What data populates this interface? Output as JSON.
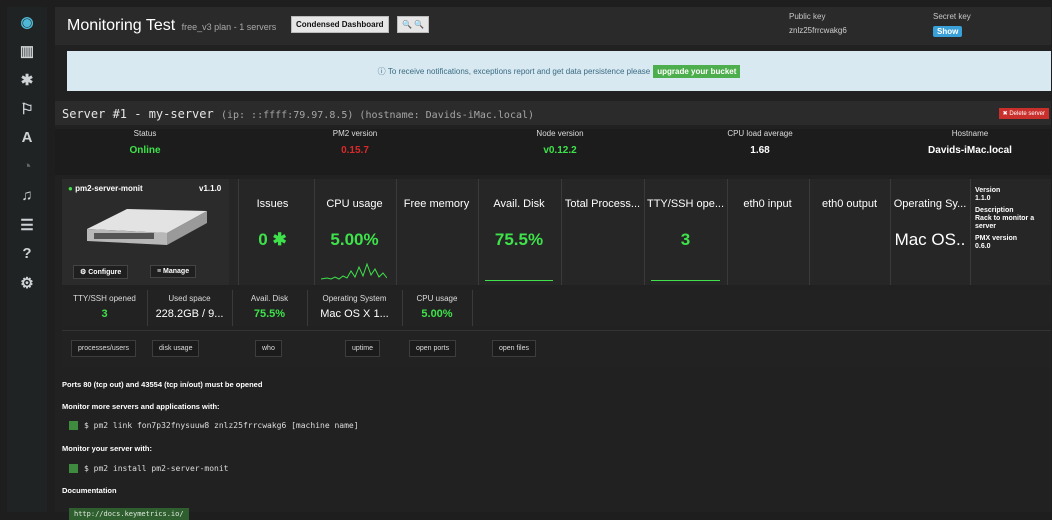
{
  "app": {
    "title": "Monitoring Test",
    "subtitle": "free_v3 plan - 1 servers",
    "condensed_label": "Condensed Dashboard",
    "public_key_label": "Public key",
    "public_key_value": "znlz25frrcwakg6",
    "secret_key_label": "Secret key",
    "show_label": "Show"
  },
  "notification": {
    "text": "To receive notifications, exceptions report and get data persistence please",
    "button": "upgrade your bucket"
  },
  "server": {
    "name": "Server #1 - my-server",
    "meta": "(ip: ::ffff:79.97.8.5) (hostname: Davids-iMac.local)",
    "delete_label": "Delete server",
    "stats": [
      {
        "label": "Status",
        "value": "Online",
        "color": "#3ee24a"
      },
      {
        "label": "PM2 version",
        "value": "0.15.7",
        "color": "#d82a2a"
      },
      {
        "label": "Node version",
        "value": "v0.12.2",
        "color": "#3ee24a"
      },
      {
        "label": "CPU load average",
        "value": "1.68",
        "color": "#ffffff"
      },
      {
        "label": "Hostname",
        "value": "Davids-iMac.local",
        "color": "#ffffff"
      }
    ]
  },
  "module": {
    "name": "pm2-server-monit",
    "version": "v1.1.0",
    "configure_label": "Configure",
    "manage_label": "Manage",
    "cards": [
      {
        "label": "Issues",
        "value": "0"
      },
      {
        "label": "CPU usage",
        "value": "5.00%"
      },
      {
        "label": "Free memory",
        "value": ""
      },
      {
        "label": "Avail. Disk",
        "value": "75.5%"
      },
      {
        "label": "Total Process...",
        "value": ""
      },
      {
        "label": "TTY/SSH ope...",
        "value": "3"
      },
      {
        "label": "eth0 input",
        "value": ""
      },
      {
        "label": "eth0 output",
        "value": ""
      },
      {
        "label": "Operating Sy...",
        "value": "Mac OS.."
      }
    ],
    "info": {
      "version_label": "Version",
      "version_value": "1.1.0",
      "desc_label": "Description",
      "desc_value": "Rack to monitor a server",
      "pmx_label": "PMX version",
      "pmx_value": "0.6.0"
    }
  },
  "metrics": [
    {
      "label": "TTY/SSH opened",
      "value": "3",
      "color": "#3ee24a"
    },
    {
      "label": "Used space",
      "value": "228.2GB / 9...",
      "color": "#ffffff"
    },
    {
      "label": "Avail. Disk",
      "value": "75.5%",
      "color": "#3ee24a"
    },
    {
      "label": "Operating System",
      "value": "Mac OS X 1...",
      "color": "#ffffff"
    },
    {
      "label": "CPU usage",
      "value": "5.00%",
      "color": "#3ee24a"
    }
  ],
  "actions": [
    "processes/users",
    "disk usage",
    "who",
    "uptime",
    "open ports",
    "open files"
  ],
  "footer": {
    "ports": "Ports 80 (tcp out) and 43554 (tcp in/out) must be opened",
    "monitor_more": "Monitor more servers and applications with:",
    "link_cmd": "$ pm2 link fon7p32fnysuuw8 znlz25frrcwakg6 [machine name]",
    "monitor_server": "Monitor your server with:",
    "install_cmd": "$ pm2 install pm2-server-monit",
    "documentation": "Documentation",
    "doc_url": "http://docs.keymetrics.io/"
  }
}
